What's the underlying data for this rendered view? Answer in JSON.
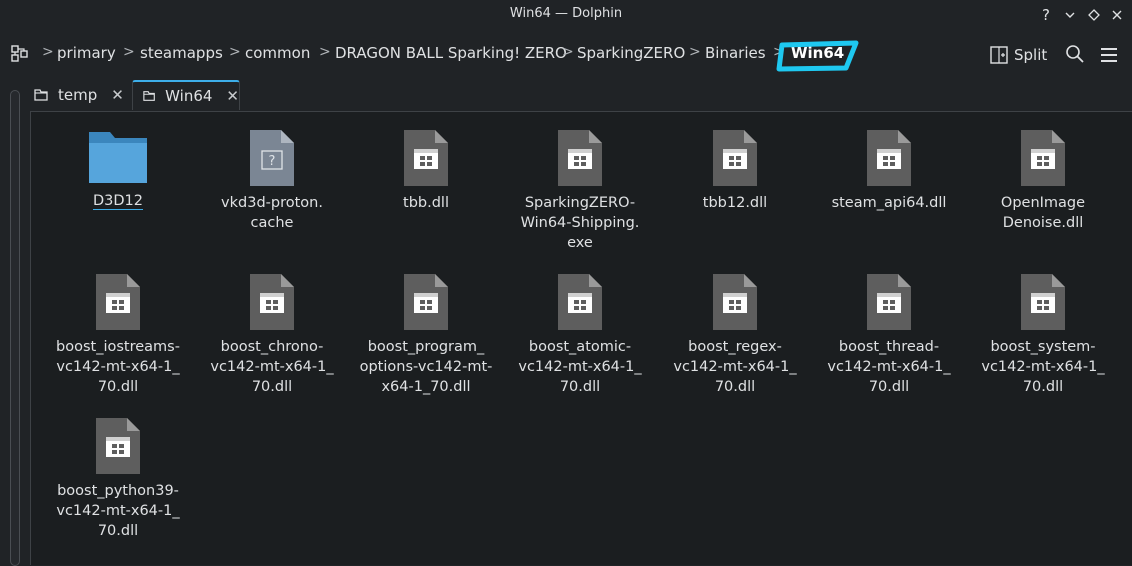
{
  "window": {
    "title": "Win64 — Dolphin",
    "help_icon": "question-mark-icon",
    "minimize_icon": "chevron-down-icon",
    "maximize_icon": "diamond-icon",
    "close_icon": "close-icon"
  },
  "breadcrumb": {
    "items": [
      "primary",
      "steamapps",
      "common",
      "DRAGON BALL Sparking! ZERO",
      "SparkingZERO",
      "Binaries",
      "Win64"
    ],
    "separator": ">"
  },
  "toolbar": {
    "split_label": "Split"
  },
  "tabs": [
    {
      "label": "temp",
      "active": false
    },
    {
      "label": "Win64",
      "active": true
    }
  ],
  "files": [
    {
      "name": "D3D12",
      "type": "folder"
    },
    {
      "name": "vkd3d-proton.\ncache",
      "type": "unknown"
    },
    {
      "name": "tbb.dll",
      "type": "binary"
    },
    {
      "name": "SparkingZERO-\nWin64-Shipping.\nexe",
      "type": "binary"
    },
    {
      "name": "tbb12.dll",
      "type": "binary"
    },
    {
      "name": "steam_api64.dll",
      "type": "binary"
    },
    {
      "name": "OpenImage\nDenoise.dll",
      "type": "binary"
    },
    {
      "name": "boost_iostreams-\nvc142-mt-x64-1_\n70.dll",
      "type": "binary"
    },
    {
      "name": "boost_chrono-\nvc142-mt-x64-1_\n70.dll",
      "type": "binary"
    },
    {
      "name": "boost_program_\noptions-vc142-mt-\nx64-1_70.dll",
      "type": "binary"
    },
    {
      "name": "boost_atomic-\nvc142-mt-x64-1_\n70.dll",
      "type": "binary"
    },
    {
      "name": "boost_regex-\nvc142-mt-x64-1_\n70.dll",
      "type": "binary"
    },
    {
      "name": "boost_thread-\nvc142-mt-x64-1_\n70.dll",
      "type": "binary"
    },
    {
      "name": "boost_system-\nvc142-mt-x64-1_\n70.dll",
      "type": "binary"
    },
    {
      "name": "boost_python39-\nvc142-mt-x64-1_\n70.dll",
      "type": "binary"
    }
  ],
  "colors": {
    "accent": "#3daee9",
    "highlight_marker": "#1ec8f0",
    "folder": "#4d9ad0"
  }
}
